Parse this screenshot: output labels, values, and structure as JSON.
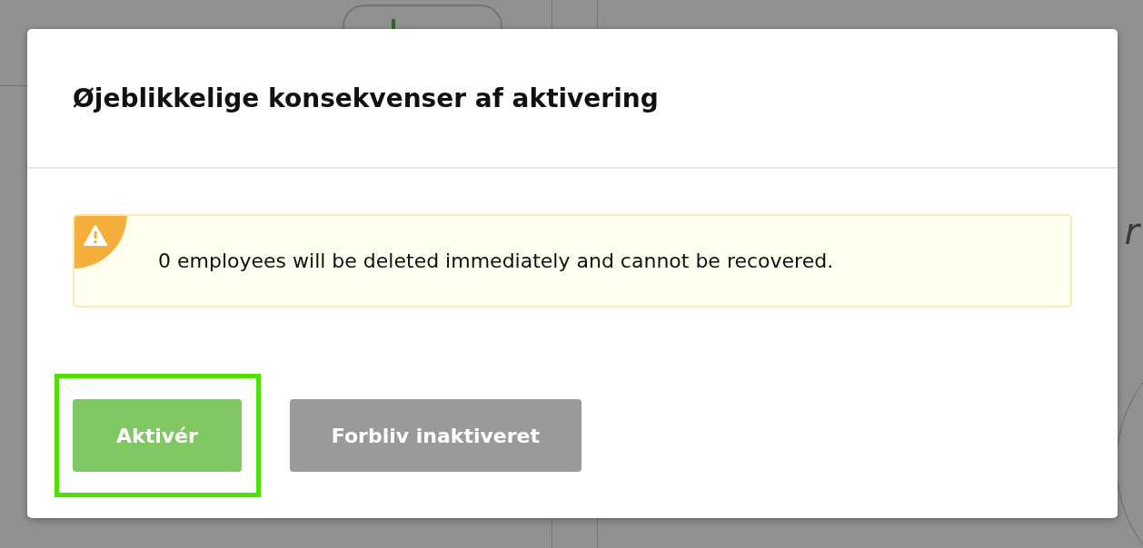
{
  "background": {
    "side_text": "r"
  },
  "dialog": {
    "title": "Øjeblikkelige konsekvenser af aktivering",
    "alert": {
      "kind": "warning",
      "message": "0 employees will be deleted immediately and cannot be recovered."
    },
    "buttons": [
      {
        "label": "Aktivér",
        "kind": "primary",
        "highlighted": true
      },
      {
        "label": "Forbliv inaktiveret",
        "kind": "secondary",
        "highlighted": false
      }
    ]
  }
}
